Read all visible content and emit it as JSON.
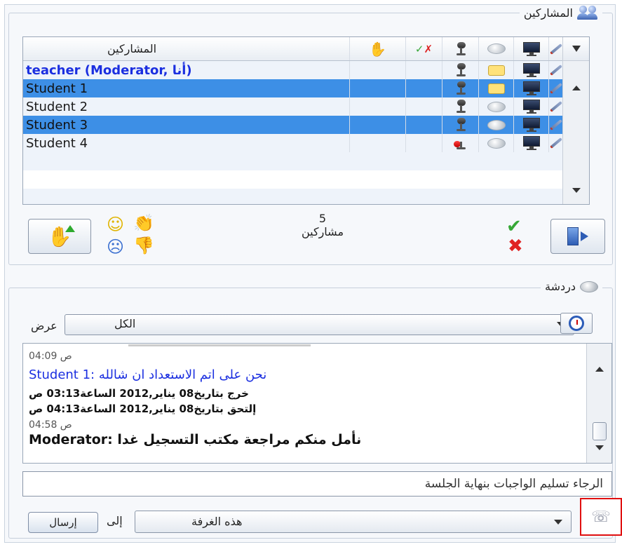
{
  "participants_panel": {
    "title": "المشاركين",
    "table": {
      "header": {
        "name": "المشاركين"
      },
      "rows": [
        {
          "name": "teacher (Moderator, أنا)",
          "style": "moderator",
          "mic": "on",
          "chat": "on"
        },
        {
          "name": "Student 1",
          "style": "selected",
          "mic": "on",
          "chat": "on"
        },
        {
          "name": "Student 2",
          "style": "plain",
          "mic": "on",
          "chat": "off"
        },
        {
          "name": "Student 3",
          "style": "selected",
          "mic": "on",
          "chat": "off"
        },
        {
          "name": "Student 4",
          "style": "plain",
          "mic": "muted",
          "chat": "off"
        }
      ]
    },
    "count_value": "5",
    "count_label": "مشاركين"
  },
  "chat_panel": {
    "title": "دردشة",
    "view_label": "عرض",
    "view_value": "الكل",
    "messages": [
      {
        "time": "04:09 ص"
      },
      {
        "text": "Student 1: نحن على اتم الاستعداد ان شالله"
      },
      {
        "text": "خرج بتاريخ08 يناير,2012 الساعة03:13 ص"
      },
      {
        "text": "إلتحق بتاريخ08 يناير,2012 الساعة04:13 ص"
      },
      {
        "time": "04:58 ص"
      },
      {
        "text": "Moderator: نأمل منكم مراجعة مكتب التسجيل غدا"
      }
    ],
    "input_value": "الرجاء تسليم الواجبات بنهاية الجلسة",
    "send_label": "إرسال",
    "to_label": "إلى",
    "to_value": "هذه الغرفة"
  },
  "colors": {
    "selection": "#3d8fe6",
    "moderator_text": "#1b2fe0",
    "highlight_box": "#e01010"
  }
}
